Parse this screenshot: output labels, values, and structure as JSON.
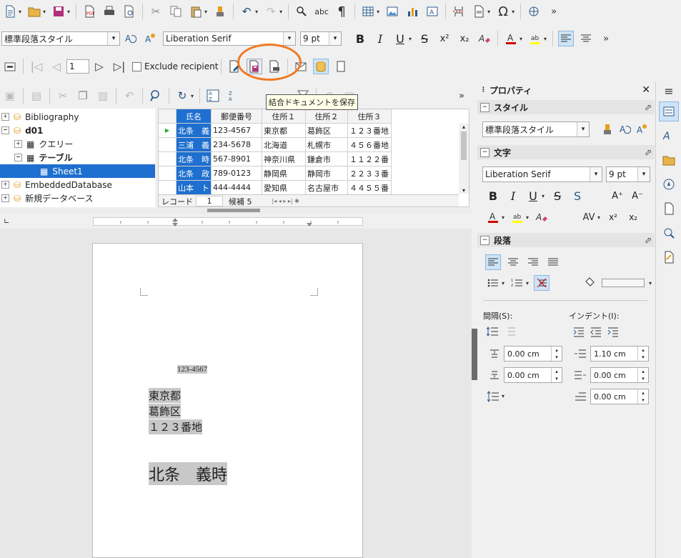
{
  "toolbar1": {
    "icons": [
      "new-document",
      "open-folder",
      "save",
      "export-pdf",
      "print",
      "print-preview",
      "cut",
      "copy",
      "paste",
      "clone-formatting",
      "undo",
      "redo",
      "find-replace",
      "spelling",
      "formatting-marks",
      "insert-table",
      "insert-image",
      "insert-chart",
      "insert-textbox",
      "page-break",
      "insert-field",
      "special-character",
      "insert-hyperlink"
    ]
  },
  "toolbar2": {
    "paragraph_style": "標準段落スタイル",
    "font_name": "Liberation Serif",
    "font_size": "9 pt",
    "bold": "B",
    "italic": "I",
    "underline": "U",
    "strikethrough": "S",
    "superscript": "x²",
    "subscript": "x₂"
  },
  "mailmerge": {
    "record_value": "1",
    "exclude_label": "Exclude recipient",
    "tooltip": "結合ドキュメントを保存"
  },
  "tree": {
    "items": [
      "Bibliography",
      "d01",
      "クエリー",
      "テーブル",
      "Sheet1",
      "EmbeddedDatabase",
      "新規データベース"
    ]
  },
  "grid": {
    "headers": [
      "氏名",
      "郵便番号",
      "住所１",
      "住所２",
      "住所３"
    ],
    "rows": [
      [
        "北条　義",
        "123-4567",
        "東京都",
        "葛飾区",
        "１２３番地"
      ],
      [
        "三浦　義",
        "234-5678",
        "北海道",
        "札幌市",
        "４５６番地"
      ],
      [
        "北条　時",
        "567-8901",
        "神奈川県",
        "鎌倉市",
        "１１２２番"
      ],
      [
        "北条　政",
        "789-0123",
        "静岡県",
        "静岡市",
        "２２３３番"
      ],
      [
        "山本　ト",
        "444-4444",
        "愛知県",
        "名古屋市",
        "４４５５番"
      ]
    ],
    "record_label": "レコード",
    "record_no": "1",
    "of_label": "候補 5"
  },
  "document": {
    "zip": "123-4567",
    "addr1": "東京都",
    "addr2": "葛飾区",
    "addr3": "１２３番地",
    "name": "北条　義時"
  },
  "sidebar": {
    "title": "プロパティ",
    "style_section": "スタイル",
    "style_value": "標準段落スタイル",
    "char_section": "文字",
    "font_name": "Liberation Serif",
    "font_size": "9 pt",
    "para_section": "段落",
    "spacing_label": "間隔(S):",
    "indent_label": "インデント(I):",
    "above": "0.00 cm",
    "below": "0.00 cm",
    "indent_before": "1.10 cm",
    "indent_after": "0.00 cm",
    "first_line": "0.00 cm"
  },
  "colors": {
    "accent": "#2f6fb7",
    "highlight_circle": "#f07a24",
    "selected_row": "#1e6fcf"
  }
}
